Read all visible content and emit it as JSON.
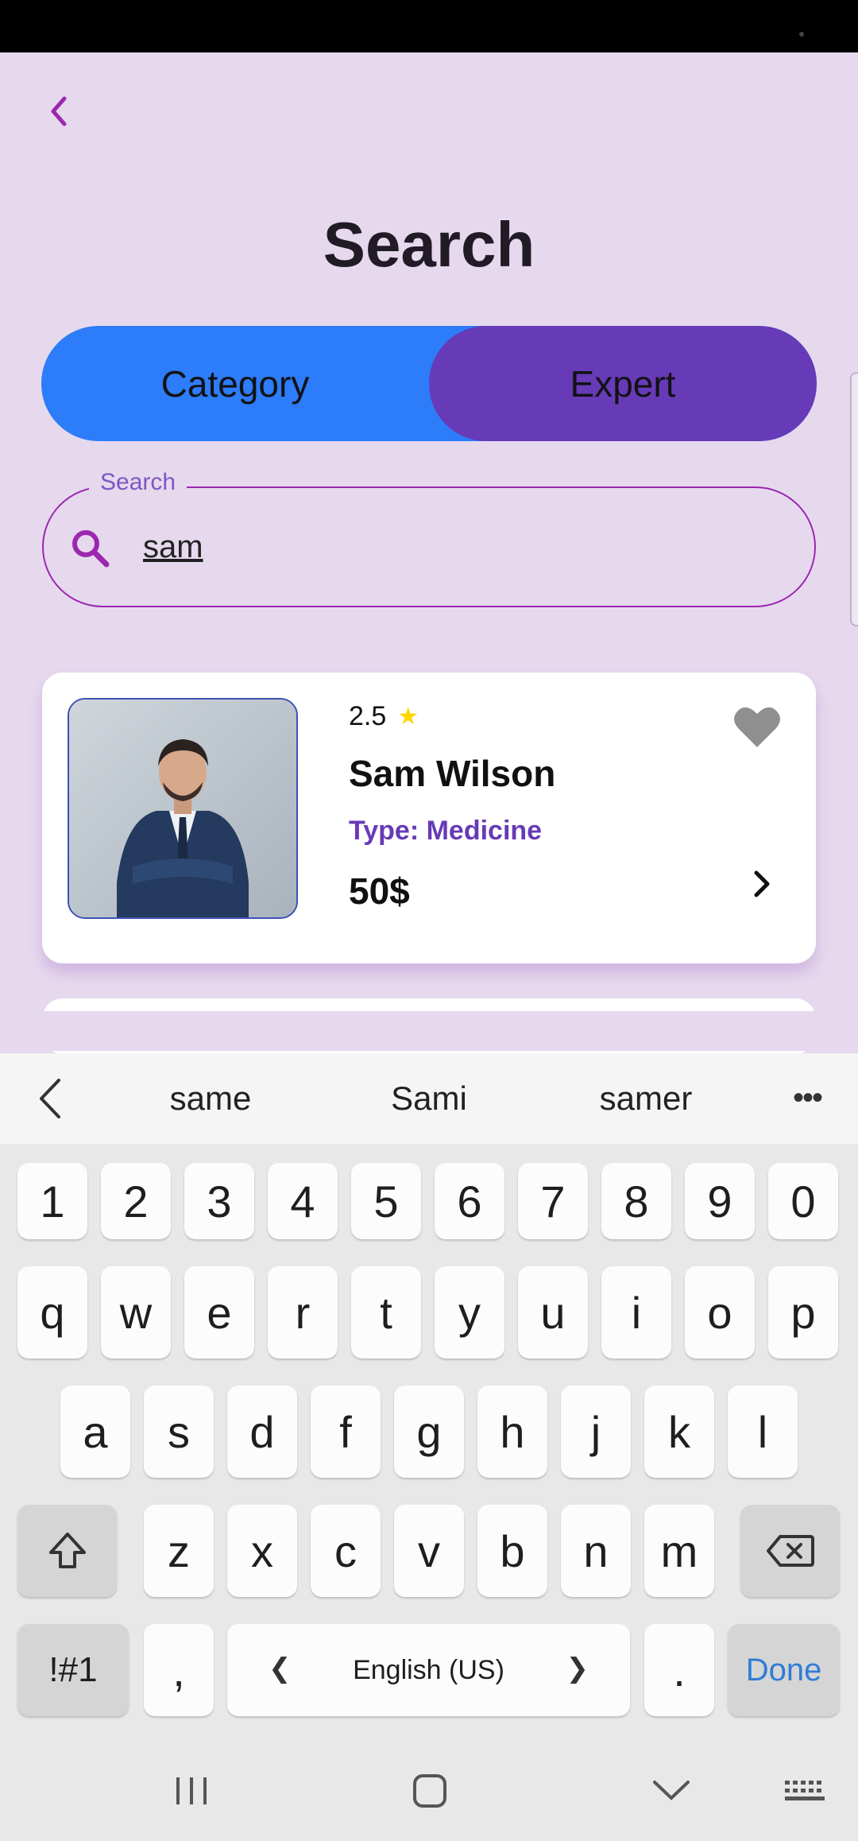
{
  "header": {
    "title": "Search"
  },
  "toggle": {
    "category_label": "Category",
    "expert_label": "Expert",
    "selected": "Expert"
  },
  "search": {
    "legend": "Search",
    "value": "sam",
    "placeholder": ""
  },
  "results": [
    {
      "rating": "2.5",
      "name": "Sam Wilson",
      "type": "Type: Medicine",
      "price": "50$",
      "favorite": false
    }
  ],
  "keyboard": {
    "suggestions": [
      "same",
      "Sami",
      "samer"
    ],
    "row_numbers": [
      "1",
      "2",
      "3",
      "4",
      "5",
      "6",
      "7",
      "8",
      "9",
      "0"
    ],
    "row_top": [
      "q",
      "w",
      "e",
      "r",
      "t",
      "y",
      "u",
      "i",
      "o",
      "p"
    ],
    "row_middle": [
      "a",
      "s",
      "d",
      "f",
      "g",
      "h",
      "j",
      "k",
      "l"
    ],
    "row_bottom": [
      "z",
      "x",
      "c",
      "v",
      "b",
      "n",
      "m"
    ],
    "symbols_label": "!#1",
    "comma_label": ",",
    "space_label": "English (US)",
    "period_label": ".",
    "done_label": "Done"
  },
  "colors": {
    "accent": "#9c27b0",
    "primary": "#673ab7",
    "category_bg": "#2d7cf9",
    "background": "#e6d9ee",
    "star": "#ffd600"
  }
}
